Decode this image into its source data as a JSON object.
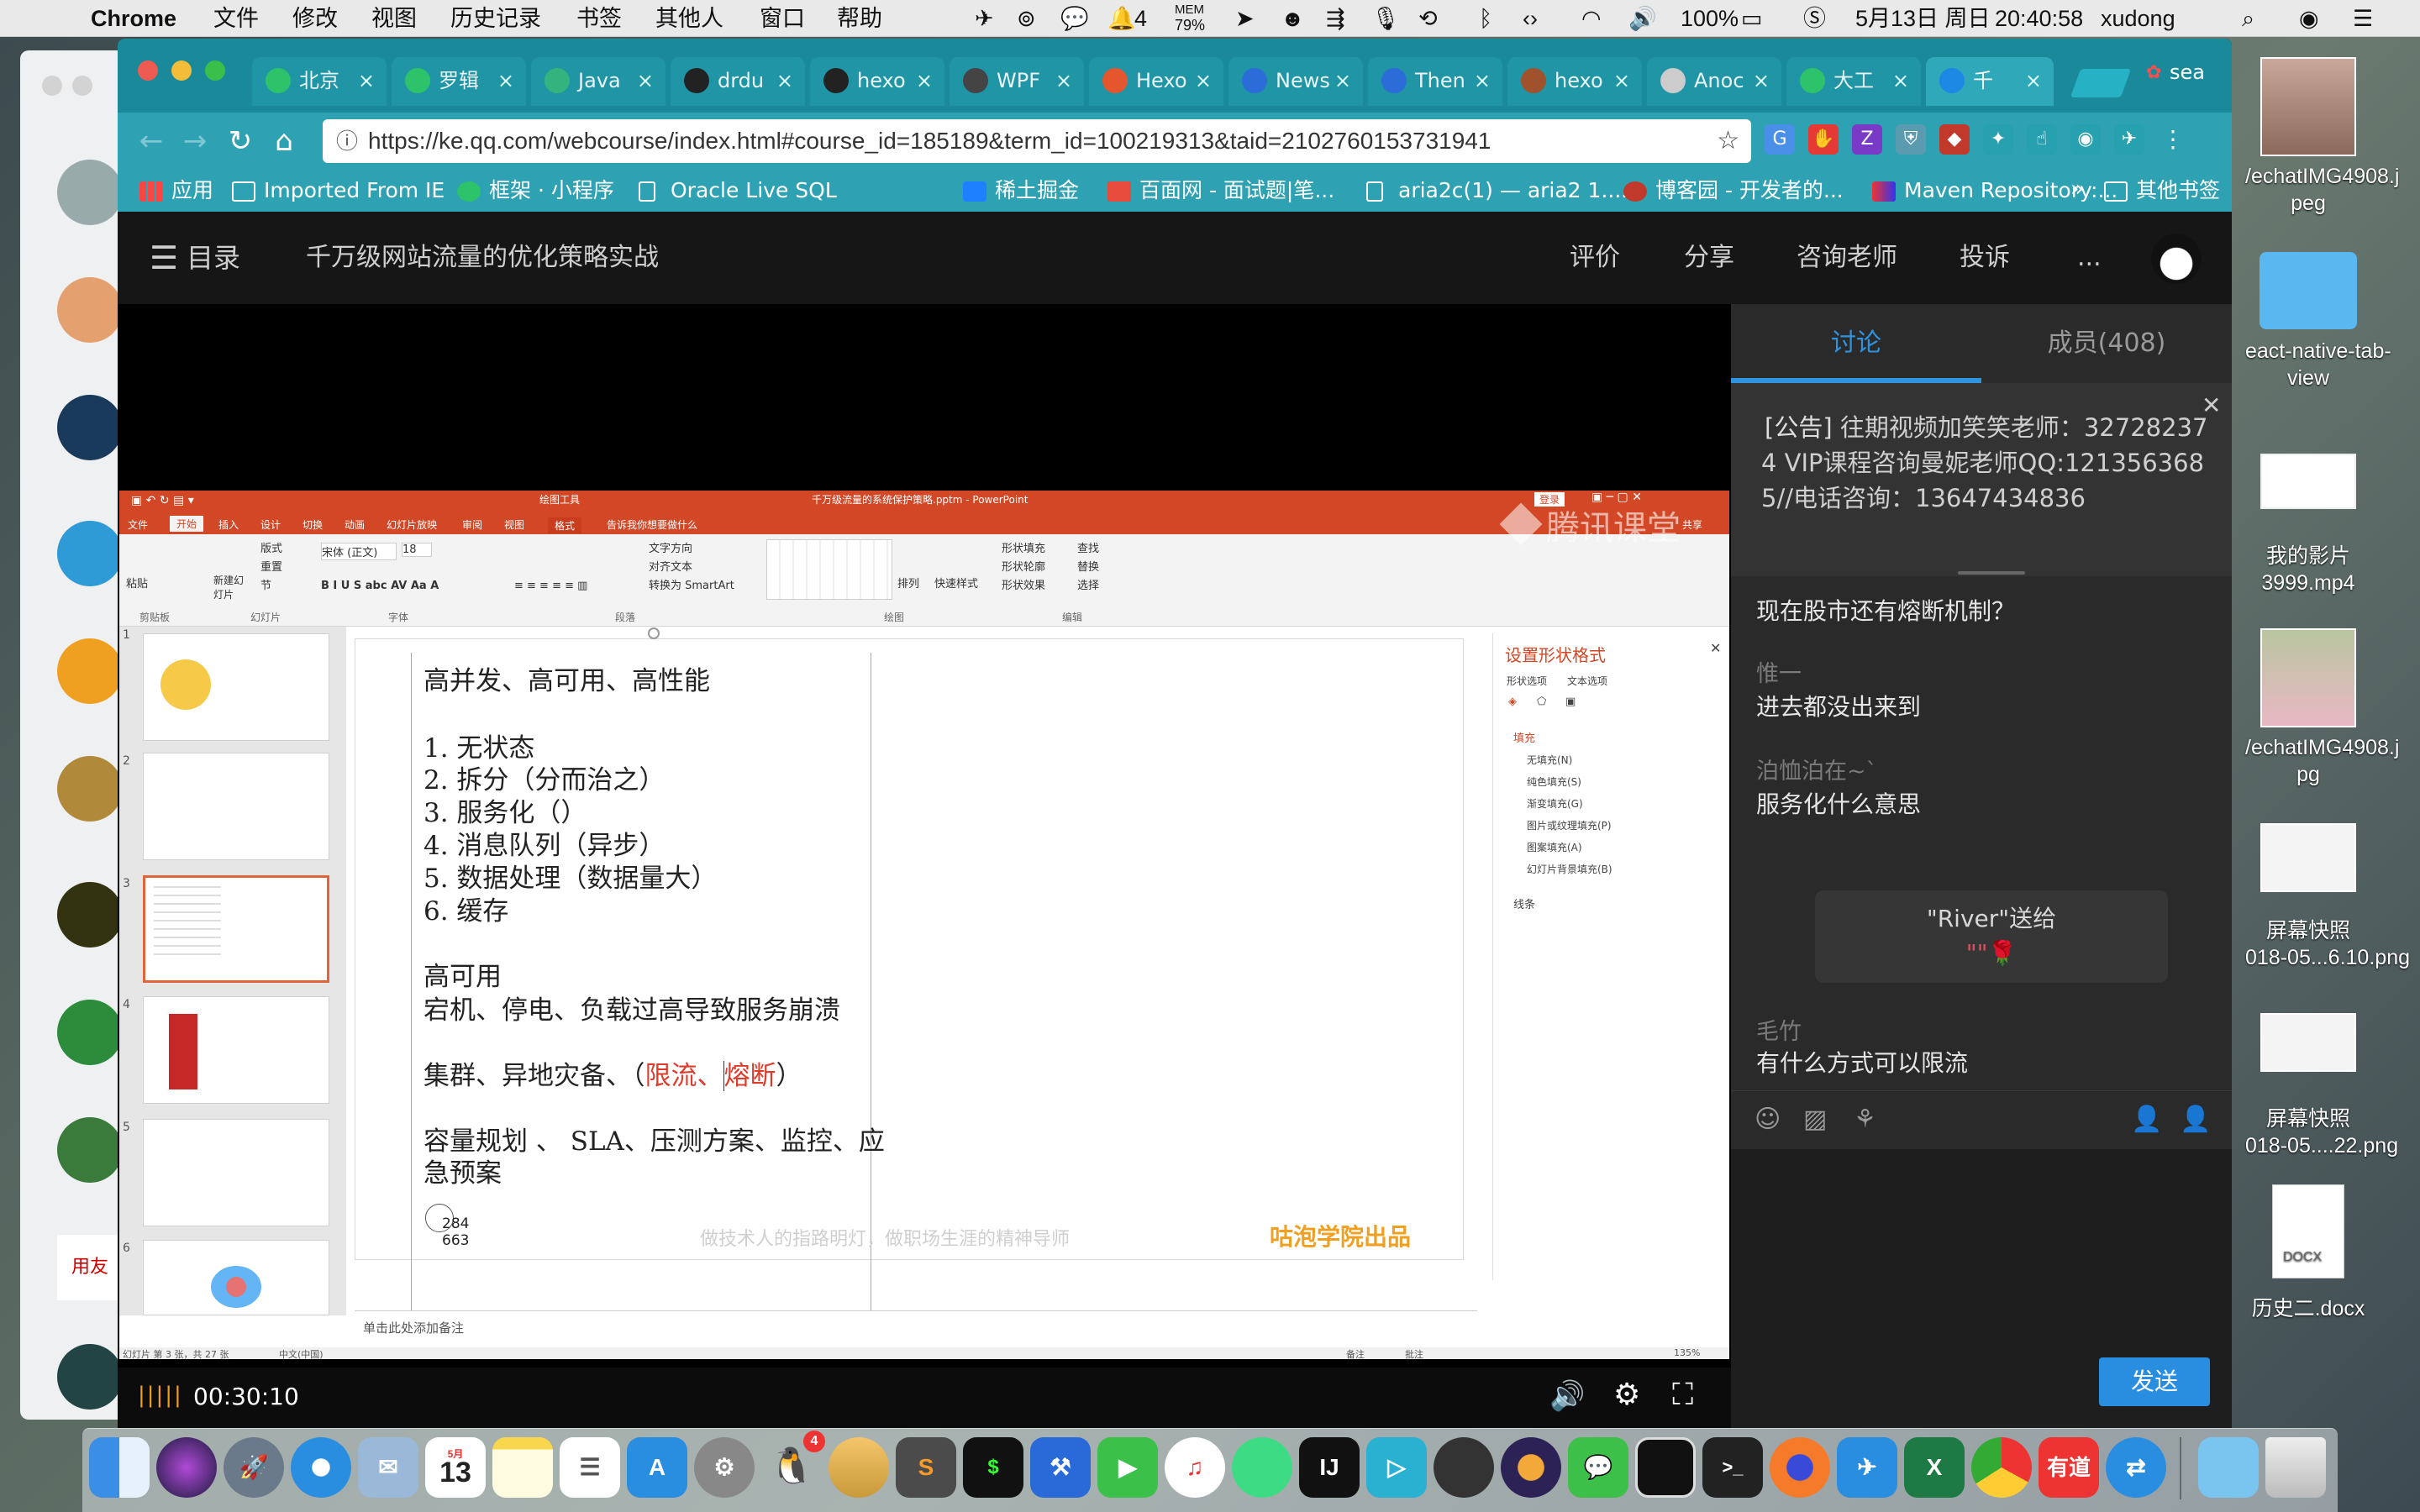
{
  "menubar": {
    "app": "Chrome",
    "menus": [
      "文件",
      "修改",
      "视图",
      "历史记录",
      "书签",
      "其他人",
      "窗口",
      "帮助"
    ],
    "notify_count": "4",
    "mem_label": "MEM",
    "mem_value": "79%",
    "battery": "100%",
    "date": "5月13日 周日",
    "time": "20:40:58",
    "user": "xudong"
  },
  "tabs": [
    {
      "label": "北京",
      "color": "#2cc36b"
    },
    {
      "label": "罗辑",
      "color": "#2cc36b"
    },
    {
      "label": "Java",
      "color": "#35b37e"
    },
    {
      "label": "drdu",
      "color": "#222222"
    },
    {
      "label": "hexo",
      "color": "#222222"
    },
    {
      "label": "WPF",
      "color": "#444444"
    },
    {
      "label": "Hexo",
      "color": "#e4572e"
    },
    {
      "label": "News",
      "color": "#2b6cd8"
    },
    {
      "label": "Then",
      "color": "#2b6cd8"
    },
    {
      "label": "hexo",
      "color": "#a0522d"
    },
    {
      "label": "Anoc",
      "color": "#cccccc"
    },
    {
      "label": "大工",
      "color": "#2cc36b"
    },
    {
      "label": "千",
      "color": "#1e88e5"
    }
  ],
  "profile_name": "sea",
  "url": "https://ke.qq.com/webcourse/index.html#course_id=185189&term_id=100219313&taid=2102760153731941",
  "url_host": "ke.qq.com",
  "bookmarks": [
    "应用",
    "Imported From IE",
    "框架 · 小程序",
    "Oracle Live SQL",
    "稀土掘金",
    "百面网 - 面试题|笔...",
    "aria2c(1) — aria2 1....",
    "博客园 - 开发者的...",
    "Maven Repository:...",
    "其他书签"
  ],
  "bookmarks_more": "»",
  "course": {
    "menu_label": "目录",
    "title": "千万级网站流量的优化策略实战",
    "actions": [
      "评价",
      "分享",
      "咨询老师",
      "投诉",
      "..."
    ]
  },
  "ppt": {
    "window_title": "千万级流量的系统保护策略.pptm - PowerPoint",
    "drawing_tools": "绘图工具",
    "login": "登录",
    "share": "共享",
    "tabs": [
      "文件",
      "开始",
      "插入",
      "设计",
      "切换",
      "动画",
      "幻灯片放映",
      "审阅",
      "视图",
      "格式"
    ],
    "tell_me": "告诉我你想要做什么",
    "groups": [
      "剪贴板",
      "幻灯片",
      "字体",
      "段落",
      "绘图",
      "编辑"
    ],
    "font_name": "宋体 (正文)",
    "font_size": "18",
    "ribbon_labels": [
      "粘贴",
      "新建幻灯片",
      "版式",
      "重置",
      "节",
      "文字方向",
      "对齐文本",
      "转换为 SmartArt",
      "排列",
      "快速样式",
      "形状填充",
      "形状轮廓",
      "形状效果",
      "查找",
      "替换",
      "选择"
    ],
    "watermark": "腾讯课堂",
    "slide_numbers": [
      "1",
      "2",
      "3",
      "4",
      "5",
      "6"
    ],
    "lines": [
      "高并发、高可用、高性能",
      "1.   无状态",
      "2.   拆分（分而治之）",
      "3.   服务化（）",
      "4.   消息队列（异步）",
      "5.   数据处理（数据量大）",
      "6.   缓存",
      "高可用",
      "宕机、停电、负载过高导致服务崩溃",
      "集群、异地灾备、（",
      "限流、",
      "熔断",
      "）",
      "容量规划 、 SLA、压测方案、监控、应",
      "急预案"
    ],
    "cursor_coords": [
      "284",
      "663"
    ],
    "footer_slogan": "做技术人的指路明灯，做职场生涯的精神导师",
    "footer_brand": "咕泡学院出品",
    "notes_placeholder": "单击此处添加备注",
    "status_left": "幻灯片 第 3 张，共 27 张",
    "status_lang": "中文(中国)",
    "status_notes": "备注",
    "status_comments": "批注",
    "status_zoom": "135%",
    "format_pane": {
      "title": "设置形状格式",
      "tab1": "形状选项",
      "tab2": "文本选项",
      "fill_header": "填充",
      "options": [
        "无填充(N)",
        "纯色填充(S)",
        "渐变填充(G)",
        "图片或纹理填充(P)",
        "图案填充(A)",
        "幻灯片背景填充(B)"
      ],
      "line_header": "线条"
    }
  },
  "player": {
    "time": "00:30:10"
  },
  "side": {
    "tab_discuss": "讨论",
    "tab_members": "成员(408)",
    "notice_tag": "[公告]",
    "notice_text": "往期视频加笑笑老师：32728237",
    "notice_line2": "4 VIP课程咨询曼妮老师QQ:121356368",
    "notice_line3": "5//电话咨询：13647434836",
    "messages": [
      {
        "name": "",
        "text": "现在股市还有熔断机制？"
      },
      {
        "name": "惟一",
        "text": "进去都没出来到"
      },
      {
        "name": "泊恤泊在~`",
        "text": "服务化什么意思"
      },
      {
        "name": "毛竹",
        "text": "有什么方式可以限流"
      }
    ],
    "gift_title": "\"River\"送给",
    "gift_body": "\"\"🌹",
    "send": "发送"
  },
  "desktop_icons": [
    {
      "label": "/echatIMG4908.j\npeg"
    },
    {
      "label": "eact-native-tab-\nview"
    },
    {
      "label": "我的影片\n3999.mp4"
    },
    {
      "label": "/echatIMG4908.j\npg"
    },
    {
      "label": "屏幕快照\n018-05...6.10.png"
    },
    {
      "label": "屏幕快照\n018-05....22.png"
    },
    {
      "label": "历史二.docx"
    }
  ],
  "docx_badge": "DOCX",
  "calendar_day": "13",
  "calendar_month": "5月",
  "qq_badge": "4",
  "dock_apps": [
    "finder-icon",
    "siri-icon",
    "launchpad-icon",
    "safari-icon",
    "mail-icon",
    "calendar-icon",
    "notes-icon",
    "reminders-icon",
    "appstore-icon",
    "preferences-icon",
    "qq-icon",
    "sequel-icon",
    "sublime-icon",
    "terminal-icon",
    "xcode-icon",
    "facetime-icon",
    "music-icon",
    "android-icon",
    "intellij-icon",
    "infuse-icon",
    "gitkraken-icon",
    "eclipse-icon",
    "wechat-icon",
    "preview-icon",
    "terminal2-icon",
    "firefox-icon",
    "mail2-icon",
    "excel-icon",
    "chrome-icon",
    "youdao-icon",
    "teamviewer-icon",
    "folder-icon",
    "trash-icon"
  ],
  "dock_labels": {
    "terminal": "$",
    "excel": "X",
    "youdao": "有道",
    "intellij": "IJ",
    "cmd": ">_"
  }
}
